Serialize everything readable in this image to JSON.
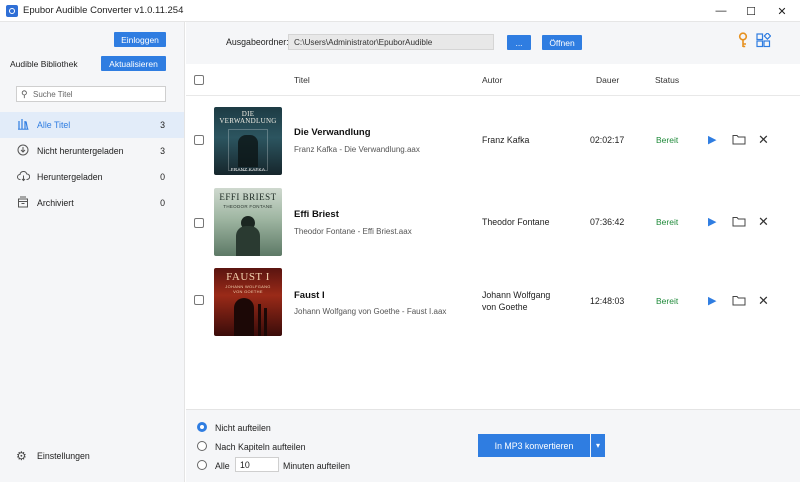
{
  "window": {
    "title": "Epubor Audible Converter v1.0.11.254",
    "minimize": "—",
    "maximize": "☐",
    "close": "✕"
  },
  "sidebar": {
    "login_label": "Einloggen",
    "library_label": "Audible Bibliothek",
    "refresh_label": "Aktualisieren",
    "search_placeholder": "Suche Titel",
    "items": [
      {
        "label": "Alle Titel",
        "count": "3",
        "icon": "books-icon"
      },
      {
        "label": "Nicht heruntergeladen",
        "count": "3",
        "icon": "download-circle-icon"
      },
      {
        "label": "Heruntergeladen",
        "count": "0",
        "icon": "cloud-download-icon"
      },
      {
        "label": "Archiviert",
        "count": "0",
        "icon": "archive-icon"
      }
    ],
    "settings_label": "Einstellungen"
  },
  "toolbar": {
    "output_label": "Ausgabeordner:",
    "output_path": "C:\\Users\\Administrator\\EpuborAudible",
    "browse_label": "...",
    "open_label": "Öffnen"
  },
  "table": {
    "headers": {
      "title": "Titel",
      "author": "Autor",
      "duration": "Dauer",
      "status": "Status"
    },
    "rows": [
      {
        "title": "Die Verwandlung",
        "file": "Franz Kafka - Die Verwandlung.aax",
        "author_line1": "Franz Kafka",
        "author_line2": "",
        "duration": "02:02:17",
        "status": "Bereit",
        "cover_title": "DIE VERWANDLUNG",
        "cover_author": "FRANZ KAFKA"
      },
      {
        "title": "Effi Briest",
        "file": "Theodor Fontane - Effi Briest.aax",
        "author_line1": "Theodor Fontane",
        "author_line2": "",
        "duration": "07:36:42",
        "status": "Bereit",
        "cover_title": "EFFI BRIEST",
        "cover_author": "THEODOR FONTANE"
      },
      {
        "title": "Faust I",
        "file": "Johann Wolfgang von Goethe - Faust I.aax",
        "author_line1": "Johann Wolfgang",
        "author_line2": "von Goethe",
        "duration": "12:48:03",
        "status": "Bereit",
        "cover_title": "FAUST I",
        "cover_author": "JOHANN WOLFGANG VON GOETHE"
      }
    ]
  },
  "footer": {
    "options": [
      {
        "label": "Nicht aufteilen",
        "selected": true
      },
      {
        "label": "Nach Kapiteln aufteilen",
        "selected": false
      },
      {
        "label": "Alle",
        "selected": false
      }
    ],
    "minutes_value": "10",
    "minutes_label": "Minuten aufteilen",
    "convert_label": "In MP3 konvertieren",
    "convert_dropdown": "▾"
  },
  "colors": {
    "accent": "#2f7de1",
    "status_ready": "#1f8a3a",
    "key": "#e69120"
  }
}
